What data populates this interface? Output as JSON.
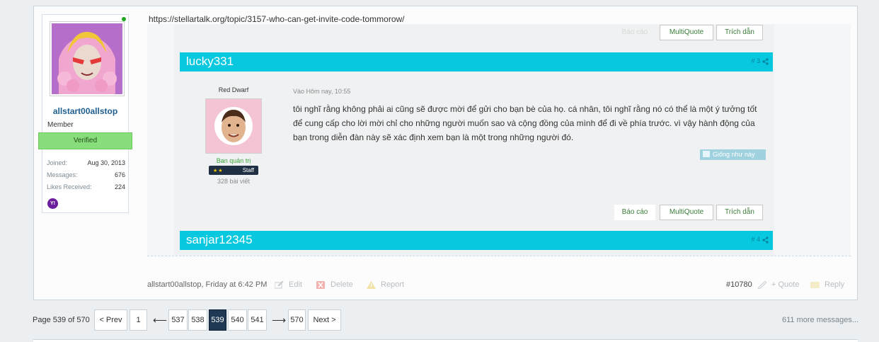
{
  "post": {
    "url": "https://stellartalk.org/topic/3157-who-can-get-invite-code-tommorow/",
    "author": {
      "name": "allstart00allstop",
      "title": "Member",
      "banner": "Verified",
      "stats": [
        {
          "label": "Joined:",
          "value": "Aug 30, 2013"
        },
        {
          "label": "Messages:",
          "value": "676"
        },
        {
          "label": "Likes Received:",
          "value": "224"
        }
      ],
      "yahoo_label": "Y!"
    },
    "meta": {
      "by_line": "allstart00allstop, Friday at 6:42 PM",
      "edit": "Edit",
      "delete": "Delete",
      "report": "Report",
      "post_number": "#10780",
      "quote": "+ Quote",
      "reply": "Reply"
    }
  },
  "embed": {
    "top_actions": {
      "report": "Báo cáo",
      "multiquote": "MultiQuote",
      "quote": "Trích dẫn"
    },
    "first_bar": {
      "name": "lucky331",
      "num": "# 3"
    },
    "inner_user": {
      "rank": "Red Dwarf",
      "role": "Ban quản trị",
      "staff_label": "Staff",
      "staff_stars": "★★",
      "posts": "328 bài viết"
    },
    "date": "Vào Hôm nay, 10:55",
    "text": "tôi nghĩ rằng không phải ai cũng sẽ được mời để gửi cho bạn bè của họ. cá nhân, tôi nghĩ rằng nó có thể là một ý tưởng tốt để cung cấp cho lời mời chỉ cho những người muốn sao và cộng đồng của mình để đi về phía trước. vì vậy hành động của bạn trong diễn đàn này sẽ xác định xem bạn là một trong những người đó.",
    "like_label": "Giống như này",
    "bottom_actions": {
      "report": "Báo cáo",
      "multiquote": "MultiQuote",
      "quote": "Trích dẫn"
    },
    "second_bar": {
      "name": "sanjar12345",
      "num": "# 4"
    }
  },
  "pagination": {
    "info": "Page 539 of 570",
    "prev": "< Prev",
    "pages": [
      "1",
      "537",
      "538",
      "539",
      "540",
      "541",
      "570"
    ],
    "current": "539",
    "arrow_left": "⟵",
    "arrow_right": "⟶",
    "next": "Next >",
    "more": "611 more messages..."
  },
  "colors": {
    "thread_bar": "#08c8df",
    "verified": "#88de7a",
    "current_page": "#1f3853",
    "username": "#1f5f90"
  }
}
